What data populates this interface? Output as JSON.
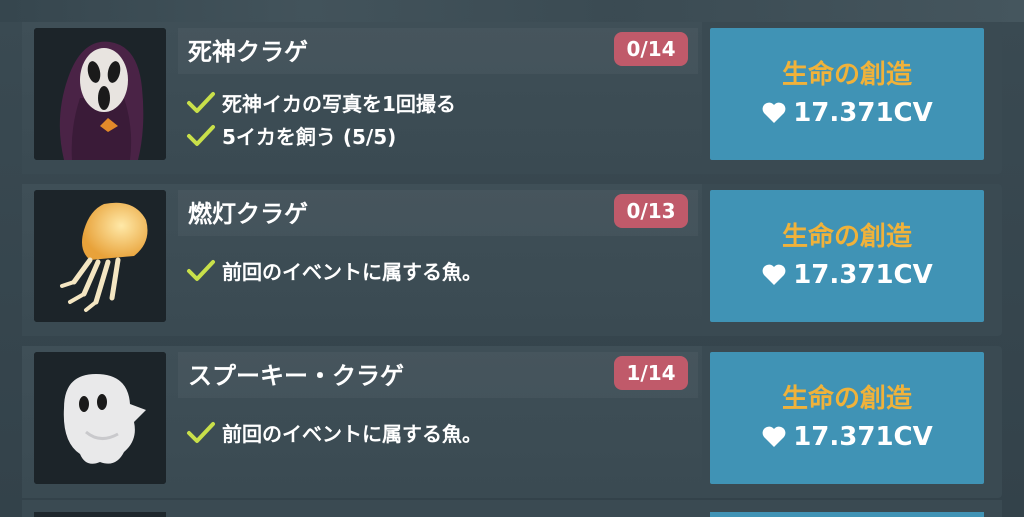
{
  "creatures": [
    {
      "name": "死神クラゲ",
      "progress": "0/14",
      "thumbnail": "grim-reaper-jellyfish",
      "requirements": [
        {
          "icon": "check-icon",
          "text": "死神イカの写真を1回撮る"
        },
        {
          "icon": "check-icon",
          "text": "5イカを飼う (5/5)"
        }
      ],
      "action": {
        "label": "生命の創造",
        "price_icon": "heart-icon",
        "price": "17.371CV"
      }
    },
    {
      "name": "燃灯クラゲ",
      "progress": "0/13",
      "thumbnail": "lantern-jellyfish",
      "requirements": [
        {
          "icon": "check-icon",
          "text": "前回のイベントに属する魚。"
        }
      ],
      "action": {
        "label": "生命の創造",
        "price_icon": "heart-icon",
        "price": "17.371CV"
      }
    },
    {
      "name": "スプーキー・クラゲ",
      "progress": "1/14",
      "thumbnail": "ghost-jellyfish",
      "requirements": [
        {
          "icon": "check-icon",
          "text": "前回のイベントに属する魚。"
        }
      ],
      "action": {
        "label": "生命の創造",
        "price_icon": "heart-icon",
        "price": "17.371CV"
      }
    }
  ],
  "colors": {
    "badge": "#c05a6a",
    "action_bg": "#4093b5",
    "action_label": "#f0b23a",
    "check": "#c9e04a"
  }
}
